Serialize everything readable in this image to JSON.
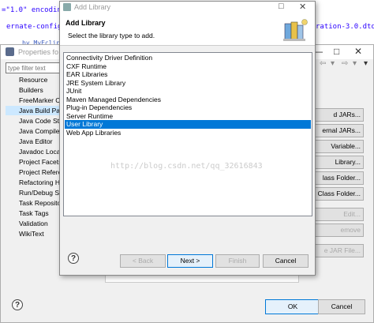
{
  "editor": {
    "line1": "=\"1.0\" encoding",
    "line2": "ernate-configur",
    "line3": "ration-3.0.dtd\"",
    "line4": "by MyEclipse P"
  },
  "properties": {
    "title": "Properties fo",
    "filter_placeholder": "type filter text",
    "tree_items": [
      "Resource",
      "Builders",
      "FreeMarker C",
      "Java Build Pat",
      "Java Code Sty",
      "Java Compiler",
      "Java Editor",
      "Javadoc Locat",
      "Project Facets",
      "Project Refere",
      "Refactoring H",
      "Run/Debug Se",
      "Task Reposito",
      "Task Tags",
      "Validation",
      "WikiText"
    ],
    "selected_tree_index": 3,
    "buttons": {
      "add_jars": "d JARs...",
      "external_jars": "ernal JARs...",
      "variable": "Variable...",
      "library": "Library...",
      "class_folder": "lass Folder...",
      "external_class_folder": "al Class Folder...",
      "edit": "Edit...",
      "remove": "emove",
      "migrate": "e JAR File...",
      "ok": "OK",
      "cancel": "Cancel"
    }
  },
  "wizard": {
    "title": "Add Library",
    "heading": "Add Library",
    "subtitle": "Select the library type to add.",
    "library_types": [
      "Connectivity Driver Definition",
      "CXF Runtime",
      "EAR Libraries",
      "JRE System Library",
      "JUnit",
      "Maven Managed Dependencies",
      "Plug-in Dependencies",
      "Server Runtime",
      "User Library",
      "Web App Libraries"
    ],
    "selected_index": 8,
    "buttons": {
      "back": "< Back",
      "next": "Next >",
      "finish": "Finish",
      "cancel": "Cancel"
    }
  },
  "watermark": "http://blog.csdn.net/qq_32616843",
  "colors": {
    "selection": "#0078d7",
    "tree_selection": "#cce8ff"
  }
}
